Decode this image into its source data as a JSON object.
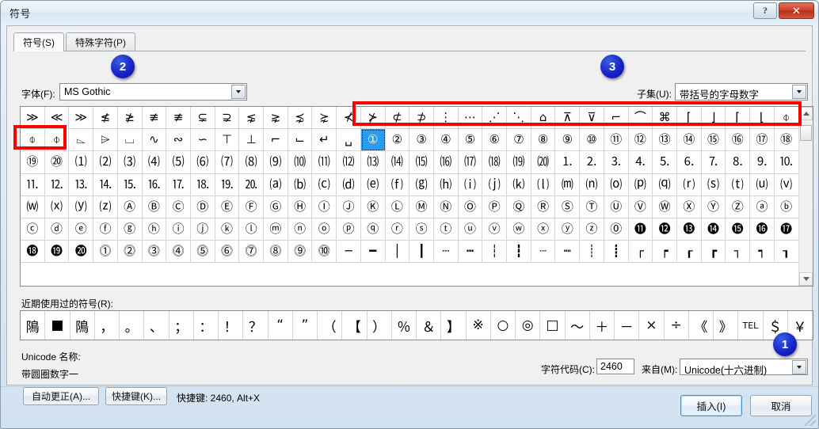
{
  "window": {
    "title": "符号",
    "help_button": "?",
    "close_button": "✕"
  },
  "tabs": [
    {
      "label": "符号(S)",
      "active": true
    },
    {
      "label": "特殊字符(P)",
      "active": false
    }
  ],
  "font_row": {
    "label": "字体(F):",
    "value": "MS Gothic"
  },
  "subset_row": {
    "label": "子集(U):",
    "value": "带括号的字母数字"
  },
  "badges": [
    {
      "id": "1",
      "label": "1"
    },
    {
      "id": "2",
      "label": "2"
    },
    {
      "id": "3",
      "label": "3"
    }
  ],
  "grid": {
    "columns": 32,
    "rows": 7,
    "selected_index": 46,
    "cells": [
      "≫",
      "≪",
      "≫",
      "≰",
      "≱",
      "≢",
      "≢",
      "⊊",
      "⊋",
      "⋦",
      "⋧",
      "⋨",
      "⋩",
      "⊀",
      "⊁",
      "⊄",
      "⊅",
      "⋮",
      "⋯",
      "⋰",
      "⋱",
      "⌂",
      "⊼",
      "⊽",
      "⌐",
      "⌒",
      "⌘",
      "⌈",
      "⌋",
      "⌈",
      "⌊",
      "⌽",
      "⌽",
      "⌽",
      "⌳",
      "⌲",
      "⌴",
      "∿",
      "∾",
      "∽",
      "⊤",
      "⊥",
      "⌐",
      "⌙",
      "↵",
      "␣",
      "①",
      "②",
      "③",
      "④",
      "⑤",
      "⑥",
      "⑦",
      "⑧",
      "⑨",
      "⑩",
      "⑪",
      "⑫",
      "⑬",
      "⑭",
      "⑮",
      "⑯",
      "⑰",
      "⑱",
      "⑲",
      "⑳",
      "⑴",
      "⑵",
      "⑶",
      "⑷",
      "⑸",
      "⑹",
      "⑺",
      "⑻",
      "⑼",
      "⑽",
      "⑾",
      "⑿",
      "⒀",
      "⒁",
      "⒂",
      "⒃",
      "⒄",
      "⒅",
      "⒆",
      "⒇",
      "⒈",
      "⒉",
      "⒊",
      "⒋",
      "⒌",
      "⒍",
      "⒎",
      "⒏",
      "⒐",
      "⒑",
      "⒒",
      "⒓",
      "⒔",
      "⒕",
      "⒖",
      "⒗",
      "⒘",
      "⒙",
      "⒚",
      "⒛",
      "⒜",
      "⒝",
      "⒞",
      "⒟",
      "⒠",
      "⒡",
      "⒢",
      "⒣",
      "⒤",
      "⒥",
      "⒦",
      "⒧",
      "⒨",
      "⒩",
      "⒪",
      "⒫",
      "⒬",
      "⒭",
      "⒮",
      "⒯",
      "⒰",
      "⒱",
      "⒲",
      "⒳",
      "⒴",
      "⒵",
      "Ⓐ",
      "Ⓑ",
      "Ⓒ",
      "Ⓓ",
      "Ⓔ",
      "Ⓕ",
      "Ⓖ",
      "Ⓗ",
      "Ⓘ",
      "Ⓙ",
      "Ⓚ",
      "Ⓛ",
      "Ⓜ",
      "Ⓝ",
      "Ⓞ",
      "Ⓟ",
      "Ⓠ",
      "Ⓡ",
      "Ⓢ",
      "Ⓣ",
      "Ⓤ",
      "Ⓥ",
      "Ⓦ",
      "Ⓧ",
      "Ⓨ",
      "Ⓩ",
      "ⓐ",
      "ⓑ",
      "ⓒ",
      "ⓓ",
      "ⓔ",
      "ⓕ",
      "ⓖ",
      "ⓗ",
      "ⓘ",
      "ⓙ",
      "ⓚ",
      "ⓛ",
      "ⓜ",
      "ⓝ",
      "ⓞ",
      "ⓟ",
      "ⓠ",
      "ⓡ",
      "ⓢ",
      "ⓣ",
      "ⓤ",
      "ⓥ",
      "ⓦ",
      "ⓧ",
      "ⓨ",
      "ⓩ",
      "⓪",
      "⓫",
      "⓬",
      "⓭",
      "⓮",
      "⓯",
      "⓰",
      "⓱",
      "⓲",
      "⓳",
      "⓴",
      "⓵",
      "⓶",
      "⓷",
      "⓸",
      "⓹",
      "⓺",
      "⓻",
      "⓼",
      "⓽",
      "⓾",
      "─",
      "━",
      "│",
      "┃",
      "┄",
      "┅",
      "┆",
      "┇",
      "┈",
      "┉",
      "┊",
      "┋",
      "┌",
      "┍",
      "┎",
      "┏",
      "┐",
      "┑",
      "┒"
    ]
  },
  "recent": {
    "label": "近期使用过的符号(R):",
    "symbols": [
      "隝",
      "■",
      "隝",
      "，",
      "。",
      "、",
      "；",
      "：",
      "！",
      "？",
      "“",
      "”",
      "（",
      "【",
      "）",
      "％",
      "＆",
      "】",
      "※",
      "○",
      "◎",
      "□",
      "～",
      "＋",
      "－",
      "×",
      "÷",
      "《",
      "》",
      "TEL",
      "＄",
      "￥"
    ]
  },
  "unicode_name": {
    "label": "Unicode 名称:",
    "value": "带圆圈数字一"
  },
  "buttons": {
    "autocorrect": "自动更正(A)...",
    "shortcut_key": "快捷键(K)...",
    "shortcut_text": "快捷键: 2460, Alt+X",
    "insert": "插入(I)",
    "cancel": "取消"
  },
  "charcode": {
    "label": "字符代码(C):",
    "value": "2460"
  },
  "from": {
    "label": "来自(M):",
    "value": "Unicode(十六进制)"
  },
  "colors": {
    "selection_blue": "#2e9bf0",
    "annotation_red": "#f60000",
    "badge_blue": "#1422c8",
    "close_red": "#c8381f"
  }
}
